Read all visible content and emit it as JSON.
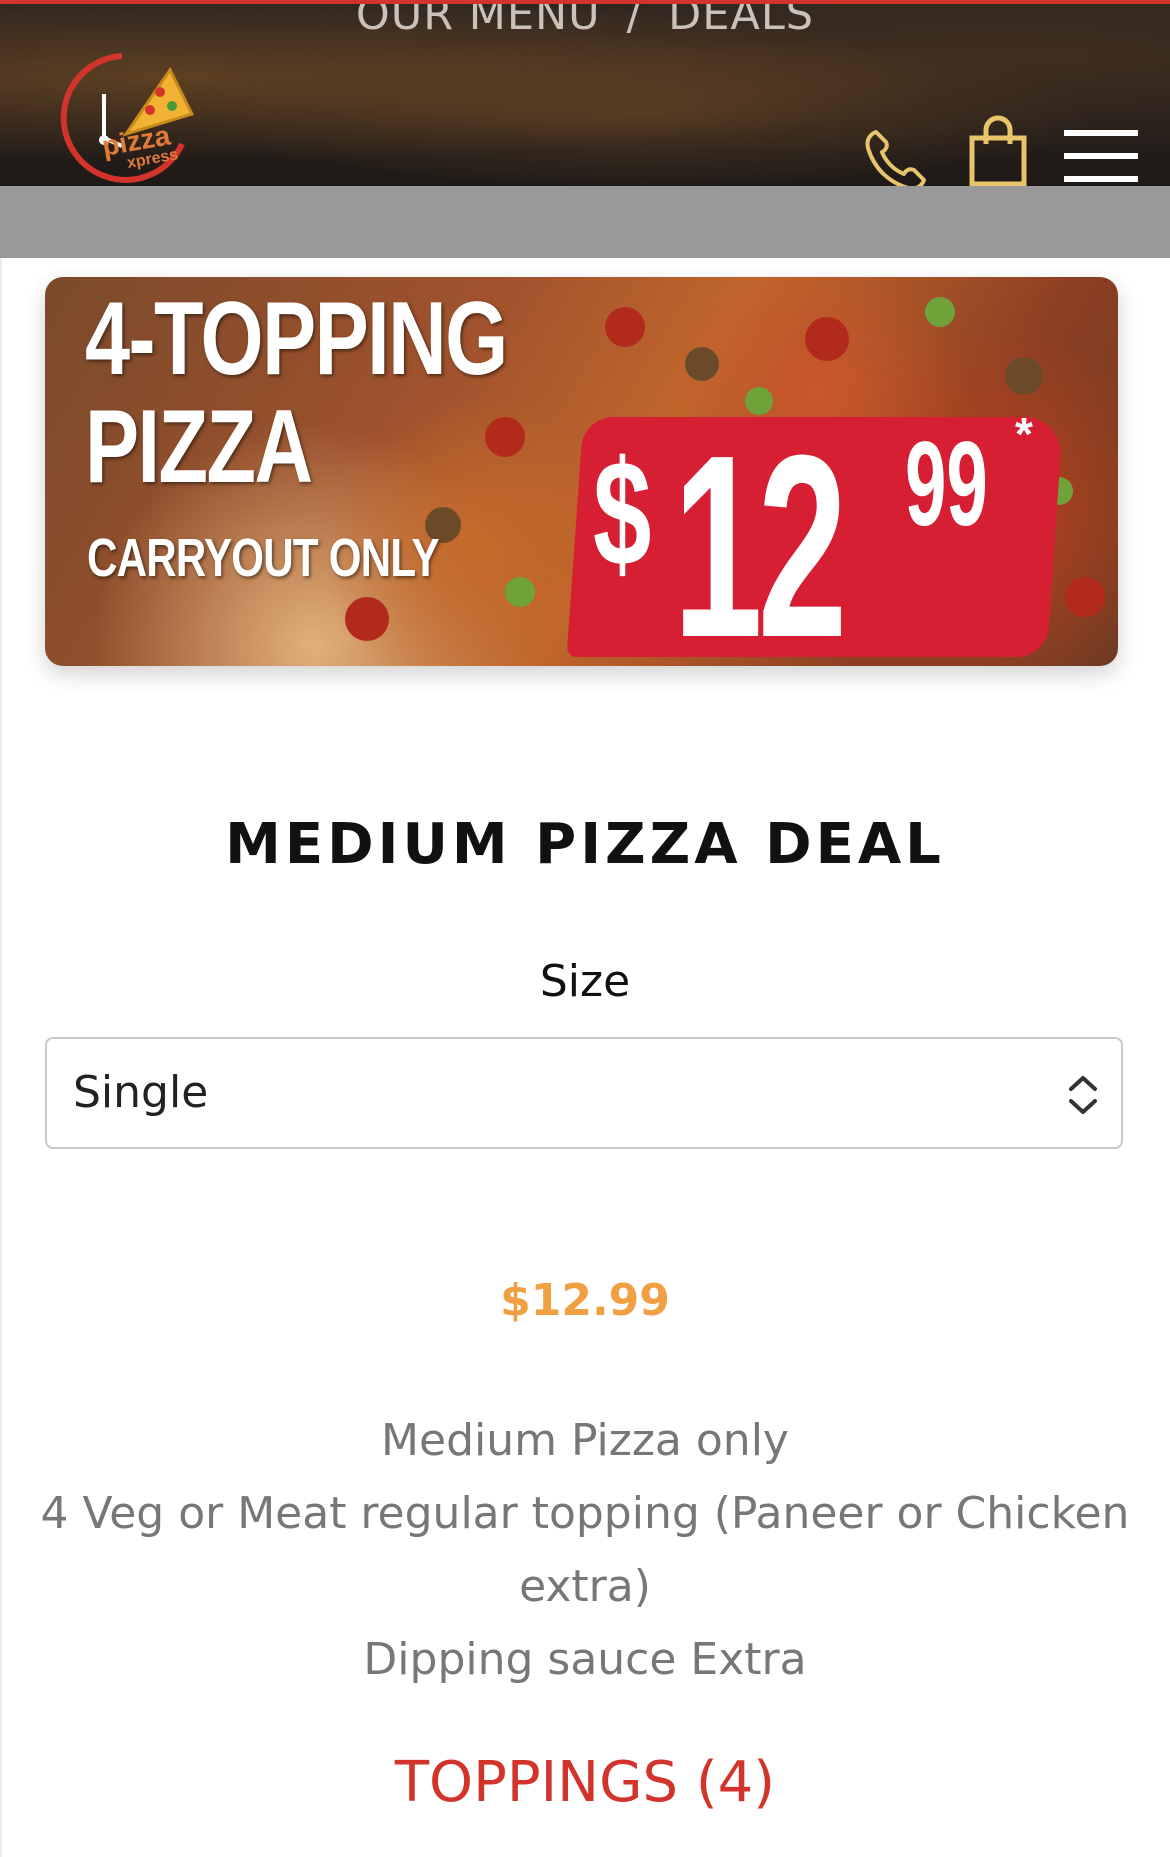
{
  "header": {
    "breadcrumb": {
      "items": [
        "OUR MENU",
        "DEALS"
      ],
      "separator": "/"
    },
    "logo_text": [
      "pizza",
      "xpress"
    ],
    "icons": {
      "phone": "phone-icon",
      "cart": "shopping-bag-icon",
      "menu": "hamburger-menu-icon"
    }
  },
  "banner": {
    "title": "4-TOPPING\nPIZZA",
    "subtitle": "CARRYOUT ONLY",
    "price_dollar": "$",
    "price_int": "12",
    "price_cents": "99",
    "price_star": "*"
  },
  "product": {
    "title": "MEDIUM PIZZA DEAL",
    "size_label": "Size",
    "size_selected": "Single",
    "price": "$12.99",
    "description": [
      "Medium Pizza only",
      "4 Veg or Meat regular topping (Paneer or Chicken extra)",
      "Dipping sauce Extra"
    ],
    "toppings_heading": "TOPPINGS (4)"
  },
  "colors": {
    "accent_red": "#d2342c",
    "price_orange": "#f0a042",
    "banner_red": "#d71f34"
  }
}
